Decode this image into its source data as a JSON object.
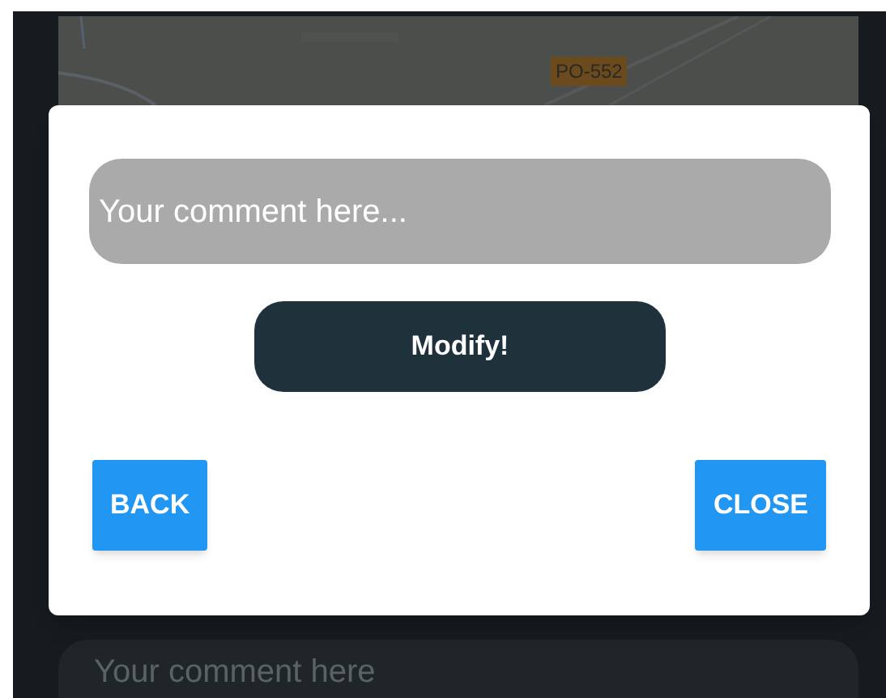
{
  "background": {
    "map": {
      "marker_label": "PO-552"
    },
    "comment_field": {
      "placeholder": "Your comment here"
    }
  },
  "dialog": {
    "comment_field": {
      "placeholder": "Your comment here..."
    },
    "submit_button": "Modify!",
    "buttons": [
      {
        "label": "BACK",
        "kind": "back"
      },
      {
        "label": "CLOSE",
        "kind": "close"
      }
    ]
  }
}
